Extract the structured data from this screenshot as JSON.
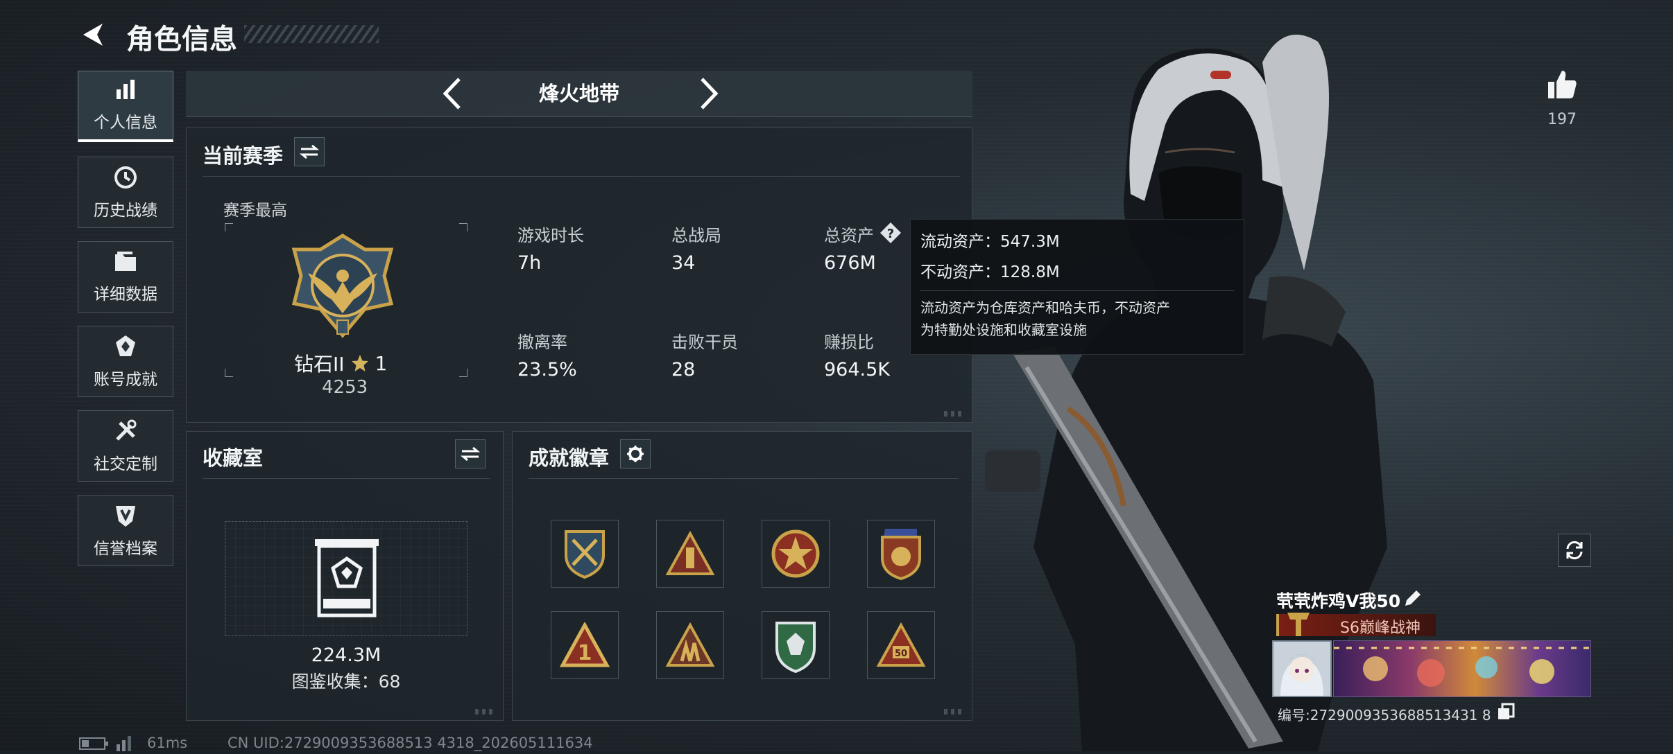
{
  "header": {
    "title": "角色信息"
  },
  "sidebar": {
    "items": [
      {
        "label": "个人信息",
        "active": true
      },
      {
        "label": "历史战绩"
      },
      {
        "label": "详细数据"
      },
      {
        "label": "账号成就"
      },
      {
        "label": "社交定制"
      },
      {
        "label": "信誉档案"
      }
    ]
  },
  "mode_switch": {
    "current": "烽火地带"
  },
  "current_season": {
    "title": "当前赛季",
    "season_best_label": "赛季最高",
    "rank_name": "钻石II",
    "rank_stars": "1",
    "rank_points": "4253",
    "stats": [
      {
        "label": "游戏时长",
        "value": "7h"
      },
      {
        "label": "总战局",
        "value": "34"
      },
      {
        "label": "总资产",
        "value": "676M"
      },
      {
        "label": "撤离率",
        "value": "23.5%"
      },
      {
        "label": "击败干员",
        "value": "28"
      },
      {
        "label": "赚损比",
        "value": "964.5K"
      }
    ]
  },
  "tooltip": {
    "line1": "流动资产：547.3M",
    "line2": "不动资产：128.8M",
    "note_line1": "流动资产为仓库资产和哈夫币，不动资产",
    "note_line2": "为特勤处设施和收藏室设施"
  },
  "collection": {
    "title": "收藏室",
    "value": "224.3M",
    "catalog_text": "图鉴收集：68"
  },
  "achievements": {
    "title": "成就徽章",
    "badges": [
      "crossed-swords-badge",
      "triangle-tower-badge",
      "star-medal-badge",
      "shield-coin-badge",
      "rank-one-badge",
      "triangle-soldiers-badge",
      "green-shield-badge",
      "fifty-triangle-badge"
    ]
  },
  "likes": {
    "count": "197"
  },
  "player": {
    "name": "茕茕炸鸡V我50",
    "title": "S6巅峰战神",
    "id_text": "编号:2729009353688513431 8"
  },
  "footer": {
    "ping": "61ms",
    "uid": "CN UID:2729009353688513 4318_202605111634"
  },
  "colors": {
    "accent_red": "#b33a2a",
    "gold": "#c9a24a",
    "panel_bg": "#1e262c",
    "tooltip_bg": "#111417"
  }
}
